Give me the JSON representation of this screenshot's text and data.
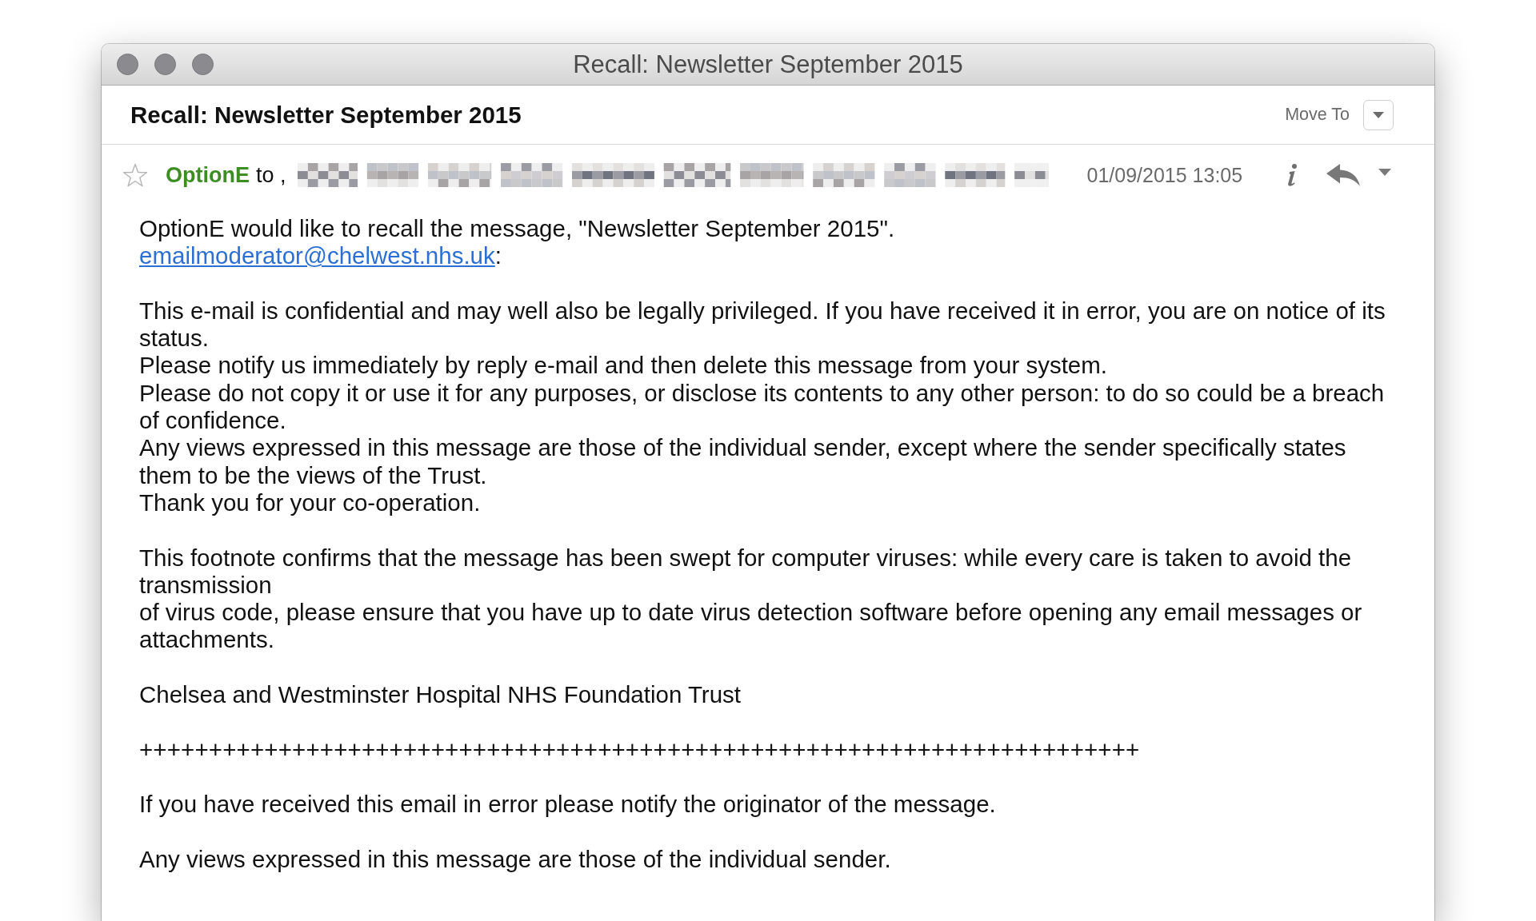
{
  "window": {
    "title": "Recall: Newsletter September 2015",
    "focused": false
  },
  "message_header": {
    "subject": "Recall: Newsletter September 2015",
    "move_to_label": "Move To"
  },
  "sender_row": {
    "starred": false,
    "sender": "OptionE",
    "to_label": "to ,",
    "date": "01/09/2015 13:05"
  },
  "body": {
    "recall_notice": {
      "text": "OptionE would like to recall the message, \"Newsletter September 2015\".",
      "link": "emailmoderator@chelwest.nhs.uk",
      "link_suffix": ":"
    },
    "blocks": [
      {
        "kind": "lines",
        "lines": [
          "This e-mail is confidential and may well also be legally privileged. If you have received it in error, you are on notice of its status.",
          "Please notify us immediately by reply e-mail and then delete this message from your system.",
          "Please do not copy it or use it for any purposes, or disclose its contents to any other person: to do so could be a breach of confidence.",
          "Any views expressed in this message are those of the individual sender, except where the sender specifically states them to be the views of the Trust.",
          "Thank you for your co-operation."
        ]
      },
      {
        "kind": "lines",
        "lines": [
          "This footnote confirms that the message has been swept for computer viruses: while every care is taken to avoid the transmission",
          "of virus code, please ensure that you have up to date virus detection software before opening any email messages or attachments."
        ]
      },
      {
        "kind": "lines",
        "lines": [
          "Chelsea and Westminster Hospital NHS Foundation Trust"
        ]
      },
      {
        "kind": "separator",
        "text": "++++++++++++++++++++++++++++++++++++++++++++++++++++++++++++++++++++++++"
      },
      {
        "kind": "lines",
        "lines": [
          "If you have received this email in error please notify the originator of the message."
        ]
      },
      {
        "kind": "lines",
        "lines": [
          "Any views expressed in this message are those of the individual sender."
        ]
      }
    ]
  }
}
